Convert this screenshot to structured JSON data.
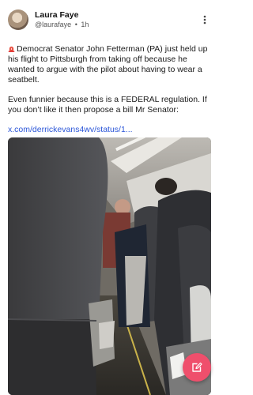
{
  "post": {
    "author_name": "Laura Faye",
    "handle": "@laurafaye",
    "time": "1h",
    "paragraph1": "Democrat Senator John Fetterman (PA) just held up his flight to Pittsburgh from taking off because he wanted to argue with the pilot about having to wear a seatbelt.",
    "paragraph2": "Even funnier because this is a FEDERAL regulation. If you don’t like it then propose a bill Mr Senator:",
    "link": "x.com/derrickevans4wv/status/1...",
    "icons": {
      "menu": "more-vertical-icon",
      "emoji": "rotating-light-icon",
      "fab": "edit-icon"
    }
  },
  "colors": {
    "accent": "#ef4f6c",
    "link": "#2a55d8"
  }
}
